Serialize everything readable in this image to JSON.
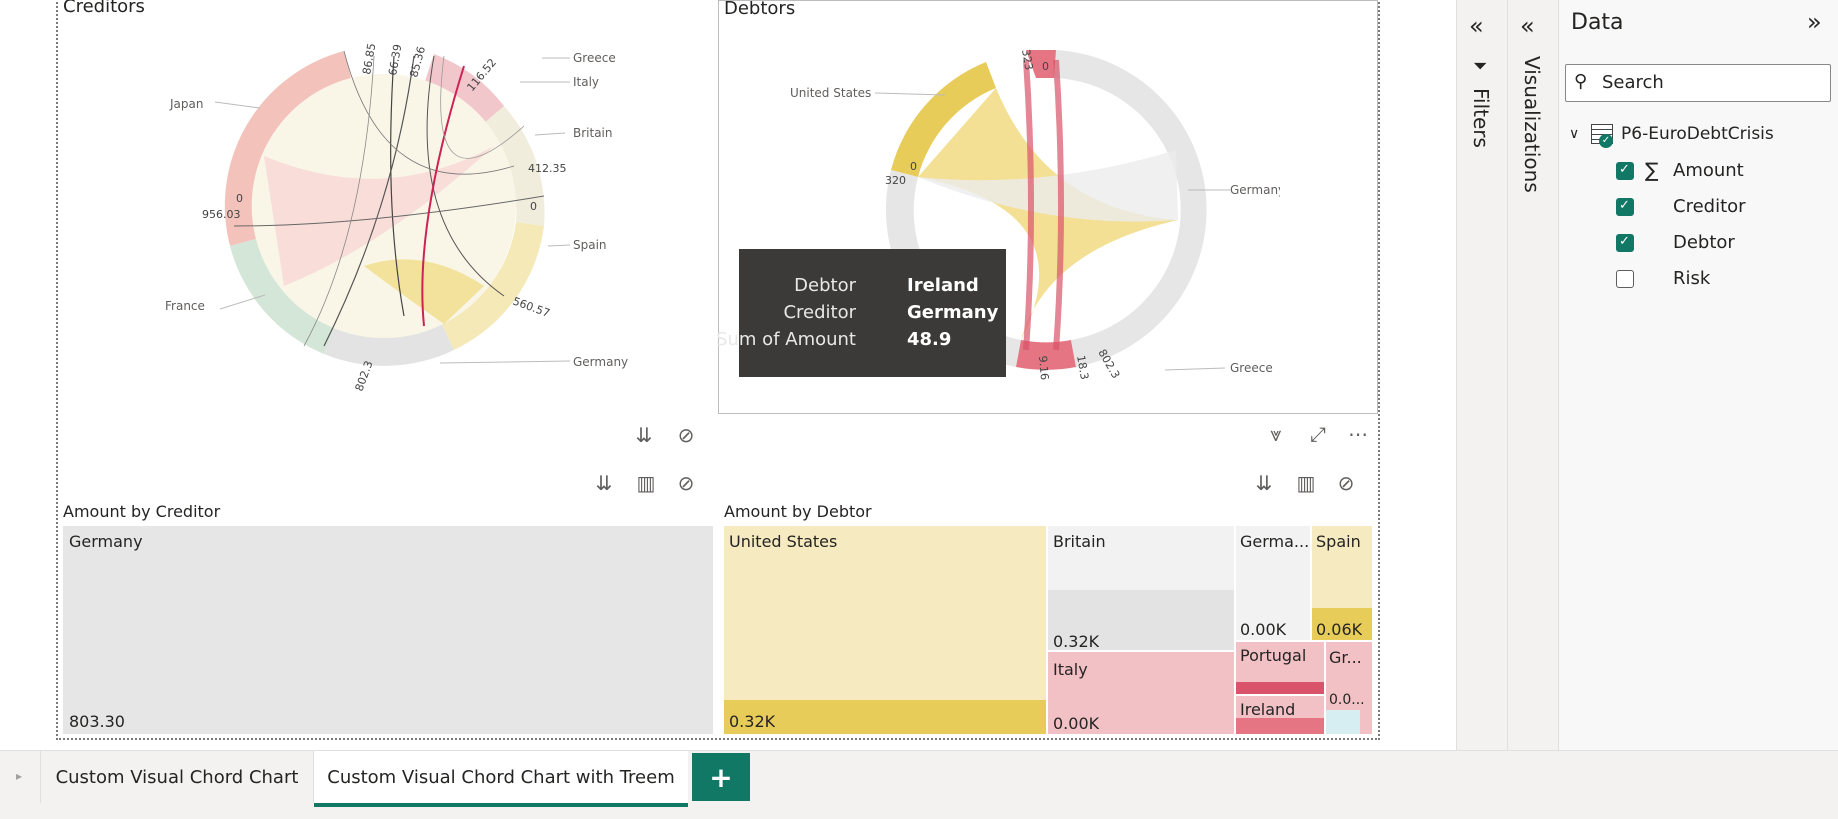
{
  "visuals": {
    "creditors": {
      "title": "Creditors",
      "labels": {
        "greece": "Greece",
        "italy": "Italy",
        "britain": "Britain",
        "spain": "Spain",
        "germany": "Germany",
        "france": "France",
        "japan": "Japan"
      },
      "ticks": {
        "t1": "956.03",
        "t2": "0",
        "t3": "802.3",
        "t4": "412.35",
        "t5": "560.57",
        "t6": "116.52",
        "t7": "86.85",
        "t8": "85.36",
        "t9": "66.39",
        "t10": "0"
      }
    },
    "debtors": {
      "title": "Debtors",
      "labels": {
        "united_states": "United States",
        "germany": "Germany",
        "greece": "Greece"
      },
      "ticks": {
        "t1": "323",
        "t2": "0",
        "t3": "320",
        "t4": "802.3",
        "t5": "18.3",
        "t6": "9.16",
        "t7": "0"
      }
    },
    "tooltip": {
      "k1": "Debtor",
      "v1": "Ireland",
      "k2": "Creditor",
      "v2": "Germany",
      "k3": "Sum of Amount",
      "v3": "48.9"
    },
    "amount_by_creditor": {
      "title": "Amount by Creditor",
      "tiles": [
        {
          "label": "Germany",
          "value": "803.30"
        }
      ]
    },
    "amount_by_debtor": {
      "title": "Amount by Debtor",
      "tiles": {
        "us_label": "United States",
        "us_value": "0.32K",
        "britain_label": "Britain",
        "britain_value": "0.32K",
        "germany_label": "Germa...",
        "germany_value": "0.00K",
        "spain_label": "Spain",
        "spain_value": "0.06K",
        "italy_label": "Italy",
        "italy_value": "0.00K",
        "portugal_label": "Portugal",
        "greece_label": "Gr...",
        "greece_value": "0.0...",
        "ireland_label": "Ireland"
      }
    }
  },
  "panes": {
    "filters_label": "Filters",
    "visualizations_label": "Visualizations",
    "data": {
      "title": "Data",
      "search_placeholder": "Search",
      "table_name": "P6-EuroDebtCrisis",
      "fields": [
        {
          "label": "Amount",
          "checked": true,
          "icon": "sigma-icon"
        },
        {
          "label": "Creditor",
          "checked": true
        },
        {
          "label": "Debtor",
          "checked": true
        },
        {
          "label": "Risk",
          "checked": false
        }
      ]
    }
  },
  "tabs": {
    "tab1": "Custom Visual Chord Chart",
    "tab2": "Custom Visual Chord Chart with Treem",
    "add": "+"
  },
  "colors": {
    "accent": "#117865",
    "yellow": "#e8cc5a",
    "pink": "#e57583",
    "grey": "#e6e6e6"
  }
}
